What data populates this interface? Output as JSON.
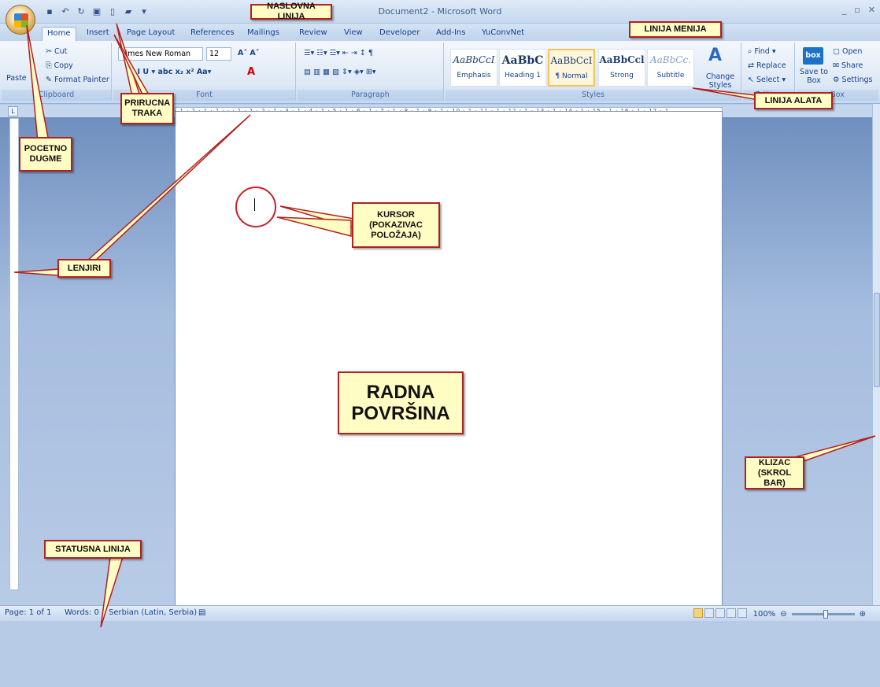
{
  "window": {
    "document_title": "Document2 - Microsoft Word",
    "controls": [
      "_",
      "▭",
      "✕"
    ]
  },
  "tabs": [
    "Home",
    "Insert",
    "Page Layout",
    "References",
    "Mailings",
    "Review",
    "View",
    "Developer",
    "Add-Ins",
    "YuConvNet"
  ],
  "active_tab": "Home",
  "ribbon": {
    "clipboard": {
      "paste": "Paste",
      "cut": "Cut",
      "copy": "Copy",
      "format_painter": "Format Painter",
      "label": "Clipboard"
    },
    "font": {
      "name": "Times New Roman",
      "size": "12",
      "label": "Font"
    },
    "paragraph": {
      "label": "Paragraph"
    },
    "styles": {
      "items": [
        {
          "preview": "AaBbCcI",
          "name": "Emphasis"
        },
        {
          "preview": "AaBbC",
          "name": "Heading 1"
        },
        {
          "preview": "AaBbCcI",
          "name": "¶ Normal"
        },
        {
          "preview": "AaBbCcl",
          "name": "Strong"
        },
        {
          "preview": "AaBbCc.",
          "name": "Subtitle"
        }
      ],
      "change_styles": "Change Styles",
      "label": "Styles"
    },
    "editing": {
      "find": "Find",
      "replace": "Replace",
      "select": "Select",
      "label": "Editing"
    },
    "box": {
      "save": "Save to Box",
      "open": "Open",
      "share": "Share",
      "settings": "Settings",
      "label": "Box",
      "logo": "box"
    }
  },
  "ruler": {
    "numbers": "· 1 · 2 · 1 · 1 · · · 1 · 1 · 2 · 1 · 3 · 1 · 4 · 1 · 5 · 1 · 6 · 1 · 7 · 1 · 8 · 1 · 9 · 1 · 10 · 1 · 11 · 1 · 12 · 1 · 13 · 1 · 14 · 1 · 15 · 1 · 16 · 1 · 17 · 1"
  },
  "status": {
    "page": "Page: 1 of 1",
    "words": "Words: 0",
    "language": "Serbian (Latin, Serbia)",
    "zoom": "100%"
  },
  "callouts": {
    "naslovna": "NASLOVNA LINIJA",
    "linija_menija": "LINIJA MENIJA",
    "pocetno": "POCETNO DUGME",
    "prirucna": "PRIRUCNA TRAKA",
    "linija_alata": "LINIJA ALATA",
    "kursor": "KURSOR (POKAZIVAC POLOŽAJA)",
    "lenjiri": "LENJIRI",
    "radna": "RADNA POVRŠINA",
    "klizac": "KLIZAC (SKROL BAR)",
    "statusna": "STATUSNA LINIJA"
  },
  "colors": {
    "callout_bg": "#fffcc4",
    "callout_border": "#b22020",
    "ribbon": "#dde8f6"
  }
}
